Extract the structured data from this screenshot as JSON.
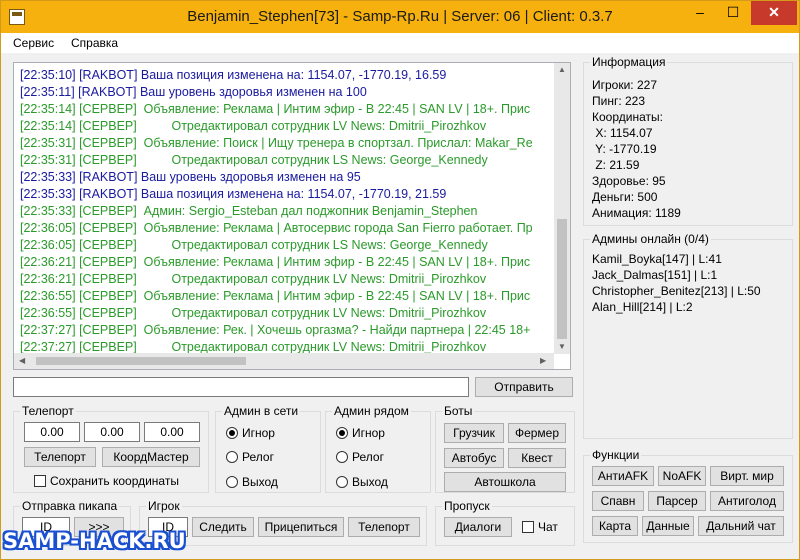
{
  "window": {
    "title": "Benjamin_Stephen[73] - Samp-Rp.Ru | Server: 06 | Client: 0.3.7",
    "controls": {
      "minimize": "–",
      "maximize": "☐",
      "close": "✕"
    }
  },
  "menu": {
    "items": [
      "Сервис",
      "Справка"
    ]
  },
  "chat": {
    "lines": [
      {
        "text": "[22:35:10] [RAKBOT] Ваша позиция изменена на: 1154.07, -1770.19, 16.59",
        "color": "#1a1aa0"
      },
      {
        "text": "[22:35:11] [RAKBOT] Ваш уровень здоровья изменен на 100",
        "color": "#1a1aa0"
      },
      {
        "text": "[22:35:14] [СЕРВЕР]  Объявление: Реклама | Интим эфир - В 22:45 | SAN LV | 18+. Прис",
        "color": "#2a9a2a"
      },
      {
        "text": "[22:35:14] [СЕРВЕР]          Отредактировал сотрудник LV News: Dmitrii_Pirozhkov",
        "color": "#2a9a2a"
      },
      {
        "text": "[22:35:31] [СЕРВЕР]  Объявление: Поиск | Ищу тренера в спортзал. Прислал: Makar_Re",
        "color": "#2a9a2a"
      },
      {
        "text": "[22:35:31] [СЕРВЕР]          Отредактировал сотрудник LS News: George_Kennedy",
        "color": "#2a9a2a"
      },
      {
        "text": "[22:35:33] [RAKBOT] Ваш уровень здоровья изменен на 95",
        "color": "#1a1aa0"
      },
      {
        "text": "[22:35:33] [RAKBOT] Ваша позиция изменена на: 1154.07, -1770.19, 21.59",
        "color": "#1a1aa0"
      },
      {
        "text": "[22:35:33] [СЕРВЕР]  Админ: Sergio_Esteban дал поджопник Benjamin_Stephen",
        "color": "#2a9a2a"
      },
      {
        "text": "[22:36:05] [СЕРВЕР]  Объявление: Реклама | Автосервис города San Fierro работает. Пр",
        "color": "#2a9a2a"
      },
      {
        "text": "[22:36:05] [СЕРВЕР]          Отредактировал сотрудник LS News: George_Kennedy",
        "color": "#2a9a2a"
      },
      {
        "text": "[22:36:21] [СЕРВЕР]  Объявление: Реклама | Интим эфир - В 22:45 | SAN LV | 18+. Прис",
        "color": "#2a9a2a"
      },
      {
        "text": "[22:36:21] [СЕРВЕР]          Отредактировал сотрудник LV News: Dmitrii_Pirozhkov",
        "color": "#2a9a2a"
      },
      {
        "text": "[22:36:55] [СЕРВЕР]  Объявление: Реклама | Интим эфир - В 22:45 | SAN LV | 18+. Прис",
        "color": "#2a9a2a"
      },
      {
        "text": "[22:36:55] [СЕРВЕР]          Отредактировал сотрудник LV News: Dmitrii_Pirozhkov",
        "color": "#2a9a2a"
      },
      {
        "text": "[22:37:27] [СЕРВЕР]  Объявление: Рек. | Хочешь оргазма? - Найди партнера | 22:45 18+",
        "color": "#2a9a2a"
      },
      {
        "text": "[22:37:27] [СЕРВЕР]          Отредактировал сотрудник LV News: Dmitrii_Pirozhkov",
        "color": "#2a9a2a"
      }
    ],
    "input_value": "",
    "send_label": "Отправить"
  },
  "info": {
    "title": "Информация",
    "lines": [
      "Игроки: 227",
      "Пинг: 223",
      "Координаты:",
      " X: 1154.07",
      " Y: -1770.19",
      " Z: 21.59",
      "Здоровье: 95",
      "Деньги: 500",
      "Анимация: 1189"
    ]
  },
  "admins_online": {
    "title": "Админы онлайн (0/4)",
    "lines": [
      "Kamil_Boyka[147] | L:41",
      "Jack_Dalmas[151] | L:1",
      "Christopher_Benitez[213] | L:50",
      "Alan_Hill[214] | L:2"
    ]
  },
  "teleport": {
    "title": "Телепорт",
    "x": "0.00",
    "y": "0.00",
    "z": "0.00",
    "teleport_label": "Телепорт",
    "coordmaster_label": "КоордМастер",
    "save_coords_label": "Сохранить координаты",
    "save_coords_checked": false
  },
  "admin_net": {
    "title": "Админ в сети",
    "options": [
      "Игнор",
      "Релог",
      "Выход"
    ],
    "selected": 0
  },
  "admin_near": {
    "title": "Админ рядом",
    "options": [
      "Игнор",
      "Релог",
      "Выход"
    ],
    "selected": 0
  },
  "bots": {
    "title": "Боты",
    "loader": "Грузчик",
    "farmer": "Фермер",
    "bus": "Автобус",
    "quest": "Квест",
    "driving_school": "Автошкола"
  },
  "functions": {
    "title": "Функции",
    "antiafk": "АнтиAFK",
    "noafk": "NoAFK",
    "virtual_world": "Вирт. мир",
    "spawn": "Спавн",
    "parser": "Парсер",
    "antihunger": "Антиголод",
    "map": "Карта",
    "data": "Данные",
    "long_chat": "Дальний чат"
  },
  "pickup": {
    "title": "Отправка пикапа",
    "id_value": "ID",
    "send": ">>>"
  },
  "player": {
    "title": "Игрок",
    "id_value": "ID",
    "follow": "Следить",
    "attach": "Прицепиться",
    "teleport": "Телепорт"
  },
  "skip": {
    "title": "Пропуск",
    "dialogs": "Диалоги",
    "chat_label": "Чат",
    "chat_checked": false
  },
  "watermark": "SAMP-HACK.RU"
}
